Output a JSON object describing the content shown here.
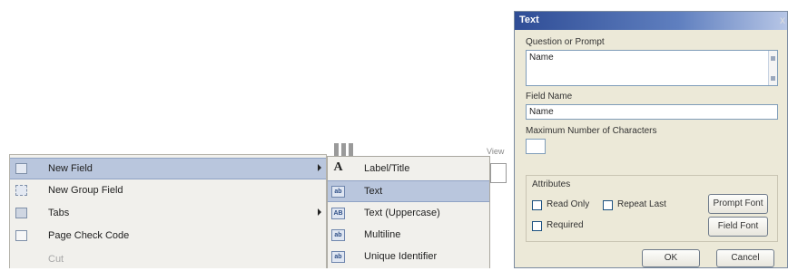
{
  "menu": {
    "items": [
      {
        "label": "New Field",
        "highlighted": true,
        "submenu": true,
        "icon": "new-field-icon"
      },
      {
        "label": "New Group Field",
        "highlighted": false,
        "submenu": false,
        "icon": "new-group-field-icon"
      },
      {
        "label": "Tabs",
        "highlighted": false,
        "submenu": true,
        "icon": "tabs-icon"
      },
      {
        "label": "Page Check Code",
        "highlighted": false,
        "submenu": false,
        "icon": "page-check-code-icon"
      },
      {
        "label": "Cut",
        "highlighted": false,
        "disabled": true,
        "icon": ""
      }
    ]
  },
  "submenu": {
    "items": [
      {
        "label": "Label/Title",
        "icon_text": "A",
        "highlighted": false
      },
      {
        "label": "Text",
        "icon_text": "ab",
        "highlighted": true
      },
      {
        "label": "Text (Uppercase)",
        "icon_text": "AB",
        "highlighted": false
      },
      {
        "label": "Multiline",
        "icon_text": "ab",
        "highlighted": false
      },
      {
        "label": "Unique Identifier",
        "icon_text": "ab",
        "highlighted": false
      }
    ]
  },
  "background": {
    "view_label": "View"
  },
  "dialog": {
    "title": "Text",
    "question_label": "Question or Prompt",
    "question_value": "Name",
    "field_name_label": "Field Name",
    "field_name_value": "Name",
    "max_chars_label": "Maximum Number of Characters",
    "max_chars_value": "",
    "attributes_label": "Attributes",
    "read_only_label": "Read Only",
    "repeat_last_label": "Repeat Last",
    "required_label": "Required",
    "prompt_font_label": "Prompt Font",
    "field_font_label": "Field Font",
    "ok_label": "OK",
    "cancel_label": "Cancel",
    "close_glyph": "x"
  },
  "colors": {
    "highlight": "#b9c6dd",
    "titlebar": "#2f4d96",
    "dialog_bg": "#ece9d8"
  }
}
